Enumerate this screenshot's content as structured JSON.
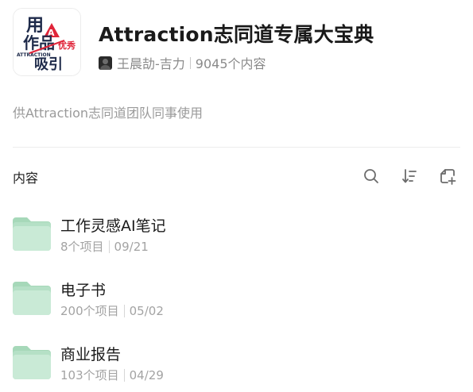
{
  "header": {
    "title": "Attraction志同道专属大宝典",
    "author": "王晨劼-吉力",
    "content_count": "9045个内容",
    "cover": {
      "lines": [
        "用",
        "作品",
        "A",
        "优秀",
        "ATTRACTION",
        "吸引"
      ],
      "colors": {
        "dark": "#1e2a4a",
        "red": "#e0253a"
      }
    }
  },
  "description": "供Attraction志同道团队同事使用",
  "section": {
    "title": "内容",
    "tools": [
      "search-icon",
      "sort-icon",
      "add-folder-icon"
    ]
  },
  "items": [
    {
      "name": "工作灵感AI笔记",
      "count": "8个项目",
      "date": "09/21"
    },
    {
      "name": "电子书",
      "count": "200个项目",
      "date": "05/02"
    },
    {
      "name": "商业报告",
      "count": "103个项目",
      "date": "04/29"
    }
  ],
  "colors": {
    "folder_back": "#b5e0c6",
    "folder_front": "#c9ead6",
    "folder_tab": "#a6d8b9",
    "muted_text": "#9a9a9a"
  }
}
